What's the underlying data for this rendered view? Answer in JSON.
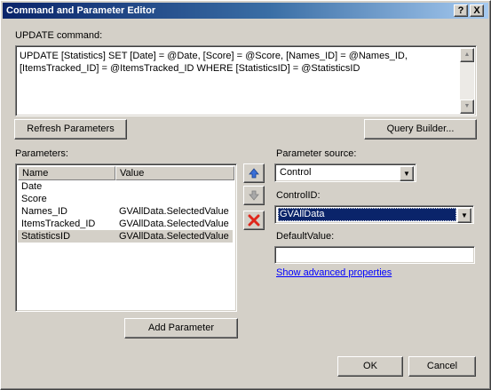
{
  "window": {
    "title": "Command and Parameter Editor",
    "help_label": "?",
    "close_label": "X"
  },
  "command": {
    "label": "UPDATE command:",
    "text": "UPDATE [Statistics] SET [Date] = @Date, [Score] = @Score, [Names_ID] = @Names_ID,\n[ItemsTracked_ID] = @ItemsTracked_ID WHERE [StatisticsID] = @StatisticsID"
  },
  "buttons": {
    "refresh": "Refresh Parameters",
    "query_builder": "Query Builder...",
    "add_parameter": "Add Parameter",
    "ok": "OK",
    "cancel": "Cancel"
  },
  "parameters": {
    "label": "Parameters:",
    "columns": [
      "Name",
      "Value"
    ],
    "rows": [
      {
        "name": "Date",
        "value": ""
      },
      {
        "name": "Score",
        "value": ""
      },
      {
        "name": "Names_ID",
        "value": "GVAllData.SelectedValue"
      },
      {
        "name": "ItemsTracked_ID",
        "value": "GVAllData.SelectedValue"
      },
      {
        "name": "StatisticsID",
        "value": "GVAllData.SelectedValue",
        "selected": true
      }
    ]
  },
  "side": {
    "source_label": "Parameter source:",
    "source_value": "Control",
    "control_label": "ControlID:",
    "control_value": "GVAllData",
    "default_label": "DefaultValue:",
    "default_value": "",
    "advanced_link": "Show advanced properties"
  },
  "icons": {
    "move_up": "arrow-up-icon",
    "move_down": "arrow-down-icon",
    "delete": "delete-x-icon"
  }
}
